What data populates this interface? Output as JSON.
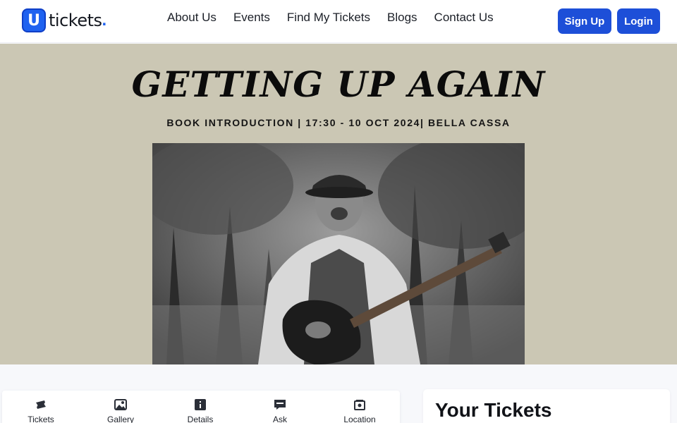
{
  "header": {
    "logo_letter": "U",
    "logo_text": "tickets",
    "logo_dot": ".",
    "nav": [
      "About Us",
      "Events",
      "Find My Tickets",
      "Blogs",
      "Contact Us"
    ],
    "signup_label": "Sign Up",
    "login_label": "Login"
  },
  "banner": {
    "title": "GETTING UP AGAIN",
    "subtitle": "BOOK INTRODUCTION | 17:30 - 10 OCT 2024| BELLA CASSA"
  },
  "tabs": [
    {
      "label": "Tickets",
      "icon": "ticket-icon"
    },
    {
      "label": "Gallery",
      "icon": "gallery-icon"
    },
    {
      "label": "Details",
      "icon": "info-icon"
    },
    {
      "label": "Ask",
      "icon": "faq-icon"
    },
    {
      "label": "Location",
      "icon": "map-icon"
    }
  ],
  "tickets_panel": {
    "title": "Your Tickets"
  },
  "colors": {
    "brand": "#1d4fd8",
    "banner_bg": "#cbc7b4"
  }
}
